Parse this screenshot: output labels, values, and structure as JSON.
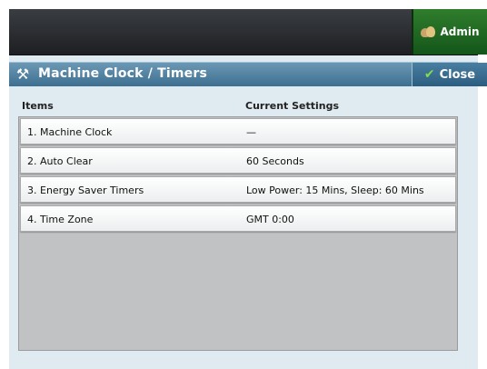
{
  "header": {
    "admin_label": "Admin"
  },
  "window": {
    "title": "Machine Clock / Timers",
    "close_label": "Close"
  },
  "table": {
    "columns": [
      "Items",
      "Current Settings"
    ],
    "rows": [
      {
        "item": "1. Machine Clock",
        "setting": "—"
      },
      {
        "item": "2. Auto Clear",
        "setting": "60 Seconds"
      },
      {
        "item": "3. Energy Saver Timers",
        "setting": "Low Power: 15 Mins, Sleep: 60 Mins"
      },
      {
        "item": "4. Time Zone",
        "setting": "GMT 0:00"
      }
    ]
  },
  "icons": {
    "admin": "admin-user-icon",
    "title": "tools-icon",
    "close": "checkmark-icon"
  },
  "colors": {
    "admin_button": "#14561a",
    "title_bar": "#3e6f91",
    "list_background": "#c1c2c4"
  }
}
